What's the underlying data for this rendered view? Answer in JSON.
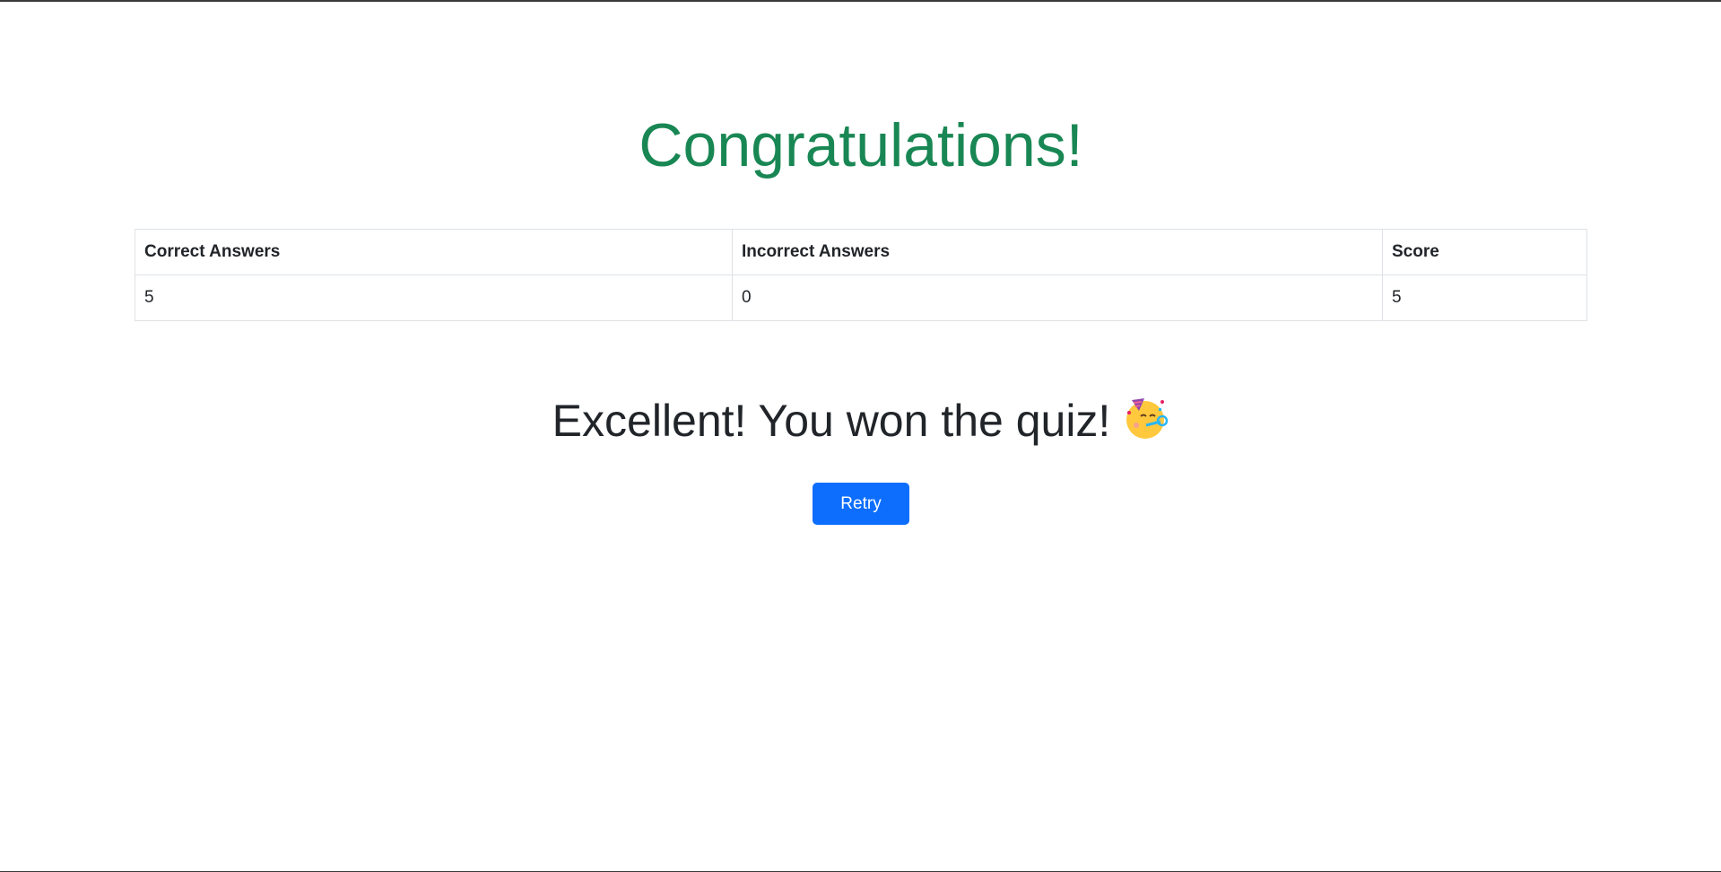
{
  "result": {
    "title": "Congratulations!",
    "title_color": "#198754",
    "table": {
      "headers": [
        "Correct Answers",
        "Incorrect Answers",
        "Score"
      ],
      "row": [
        "5",
        "0",
        "5"
      ]
    },
    "message": "Excellent! You won the quiz!",
    "message_icon": "partying-face-emoji",
    "retry_label": "Retry",
    "retry_color": "#0d6efd"
  }
}
